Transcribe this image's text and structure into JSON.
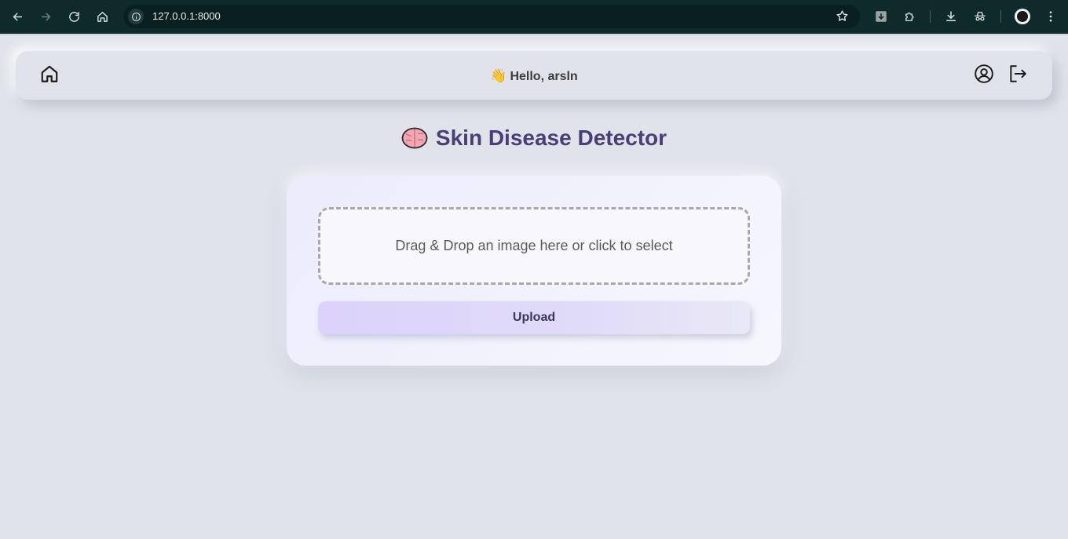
{
  "browser": {
    "url": "127.0.0.1:8000"
  },
  "navbar": {
    "wave_emoji": "👋",
    "greeting": "Hello, arsln"
  },
  "page": {
    "title": "Skin Disease Detector"
  },
  "upload": {
    "dropzone_text": "Drag & Drop an image here or click to select",
    "button_label": "Upload"
  },
  "colors": {
    "title": "#4a3d78",
    "background": "#e0e4ea",
    "button": "#dcd2fb"
  }
}
